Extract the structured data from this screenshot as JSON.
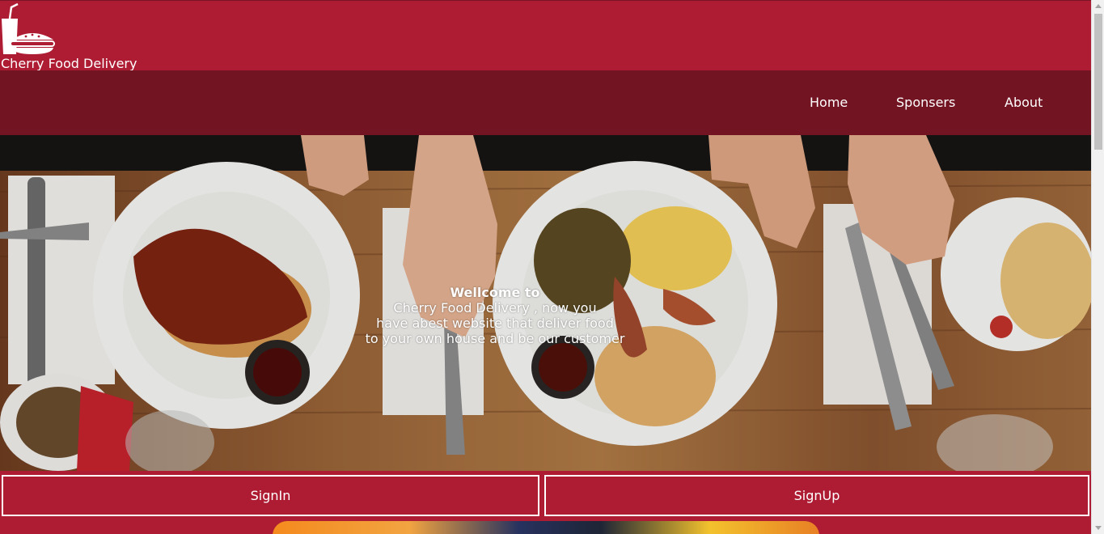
{
  "header": {
    "brand": "Cherry Food Delivery",
    "logo_icon": "food-delivery-logo-icon"
  },
  "nav": {
    "items": [
      {
        "label": "Home"
      },
      {
        "label": "Sponsers"
      },
      {
        "label": "About"
      }
    ]
  },
  "hero": {
    "welcome_title": "Wellcome to",
    "welcome_lines": [
      "Cherry Food Delivery , now you",
      "have abest website that deliver food",
      "to your own house and be our customer"
    ]
  },
  "auth": {
    "signin_label": "SignIn",
    "signup_label": "SignUp"
  },
  "colors": {
    "brand_red": "#ad1c33",
    "nav_dark_red": "#731423",
    "text": "#ffffff"
  }
}
